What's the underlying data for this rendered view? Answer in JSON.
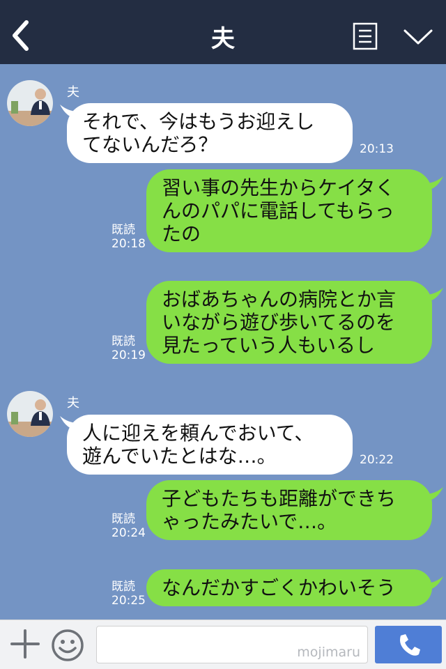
{
  "header": {
    "title": "夫",
    "icons": {
      "back": "chevron-left-icon",
      "notes": "notes-icon",
      "menu": "chevron-down-icon"
    }
  },
  "messages": [
    {
      "type": "incoming",
      "sender": "夫",
      "text": "それで、今はもうお迎えし\nてないんだろ？",
      "time": "20:13"
    },
    {
      "type": "outgoing",
      "read": "既読",
      "text": "習い事の先生からケイタく\nんのパパに電話してもらっ\nたの",
      "time": "20:18"
    },
    {
      "type": "outgoing",
      "read": "既読",
      "text": "おばあちゃんの病院とか言\nいながら遊び歩いてるのを\n見たっていう人もいるし",
      "time": "20:19"
    },
    {
      "type": "incoming",
      "sender": "夫",
      "text": "人に迎えを頼んでおいて、\n遊んでいたとはな…。",
      "time": "20:22"
    },
    {
      "type": "outgoing",
      "read": "既読",
      "text": "子どもたちも距離ができち\nゃったみたいで…。",
      "time": "20:24"
    },
    {
      "type": "outgoing",
      "read": "既読",
      "text": "なんだかすごくかわいそう",
      "time": "20:25"
    }
  ],
  "input": {
    "value": "",
    "watermark": "mojimaru"
  },
  "colors": {
    "header_bg": "#232d42",
    "chat_bg": "#7494c4",
    "outgoing_bubble": "#86df46",
    "incoming_bubble": "#ffffff",
    "send_button": "#4f7ed6"
  }
}
